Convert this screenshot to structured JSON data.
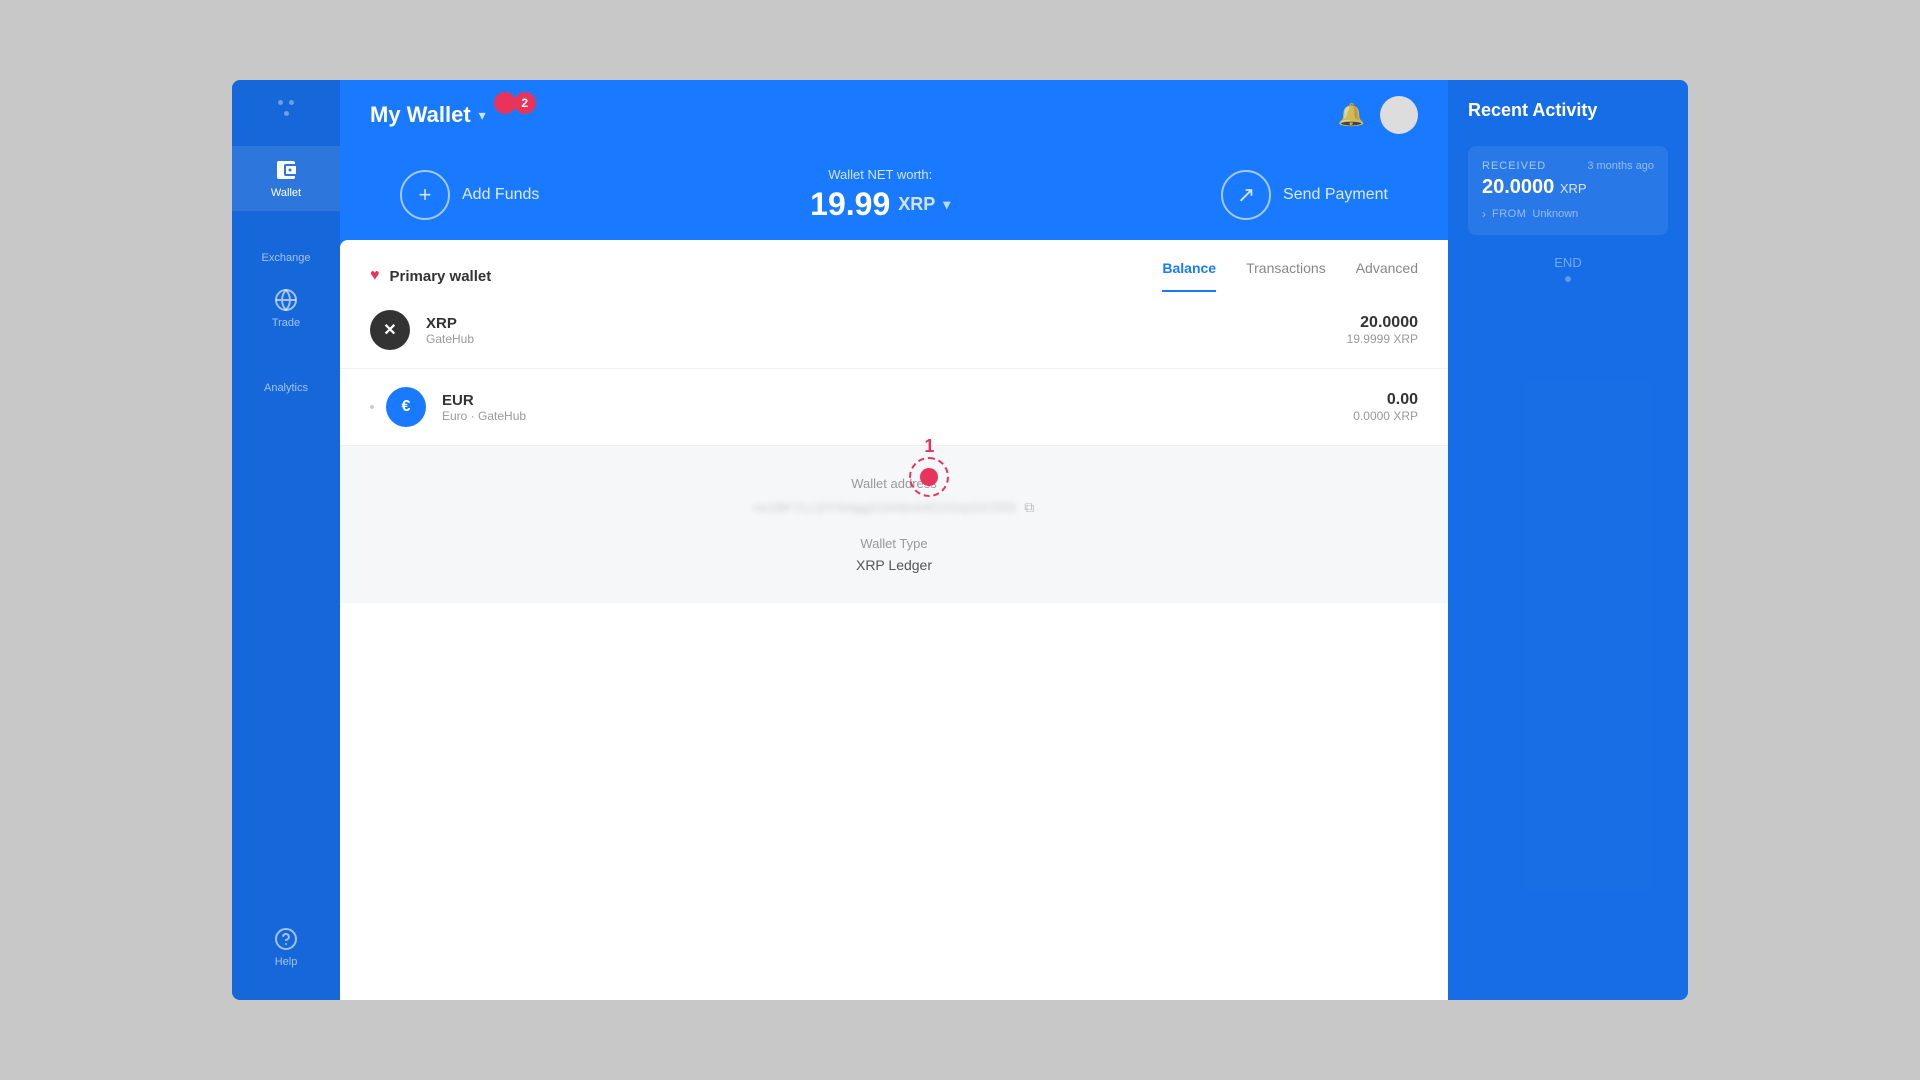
{
  "app": {
    "title": "My Wallet",
    "badge": "2"
  },
  "header": {
    "title": "My Wallet",
    "chevron": "▾",
    "bell_label": "🔔",
    "avatar_alt": "User avatar"
  },
  "action_bar": {
    "add_funds_label": "Add Funds",
    "wallet_net_worth_label": "Wallet NET worth:",
    "wallet_net_worth_value": "19.99",
    "wallet_net_worth_currency": "XRP",
    "send_payment_label": "Send Payment"
  },
  "wallet": {
    "name": "Primary wallet",
    "tabs": [
      {
        "label": "Balance",
        "active": true
      },
      {
        "label": "Transactions",
        "active": false
      },
      {
        "label": "Advanced",
        "active": false
      }
    ],
    "currencies": [
      {
        "symbol": "XRP",
        "icon_text": "✕",
        "icon_class": "xrp",
        "name": "XRP",
        "sub": "GateHub",
        "balance_main": "20.0000",
        "balance_sub": "19.9999 XRP"
      },
      {
        "symbol": "EUR",
        "icon_text": "€",
        "icon_class": "eur",
        "name": "EUR",
        "sub": "Euro · GateHub",
        "balance_main": "0.00",
        "balance_sub": "0.0000 XRP"
      }
    ],
    "address_label": "Wallet address",
    "address_value": "rw1BF7Lc1fYN4gg01bhbnk8D2GtpGC0S5",
    "wallet_type_label": "Wallet Type",
    "wallet_type_value": "XRP Ledger"
  },
  "recent_activity": {
    "title": "Recent Activity",
    "items": [
      {
        "type": "RECEIVED",
        "time": "3 months ago",
        "amount": "20.0000",
        "currency": "XRP",
        "from_label": "FROM",
        "from_value": "Unknown"
      }
    ],
    "end_label": "END"
  },
  "sidebar": {
    "items": [
      {
        "label": "Wallet",
        "active": true,
        "icon": "wallet"
      },
      {
        "label": "Exchange",
        "active": false,
        "icon": "exchange"
      },
      {
        "label": "Trade",
        "active": false,
        "icon": "trade"
      },
      {
        "label": "Analytics",
        "active": false,
        "icon": "analytics"
      },
      {
        "label": "Help",
        "active": false,
        "icon": "help"
      }
    ]
  }
}
